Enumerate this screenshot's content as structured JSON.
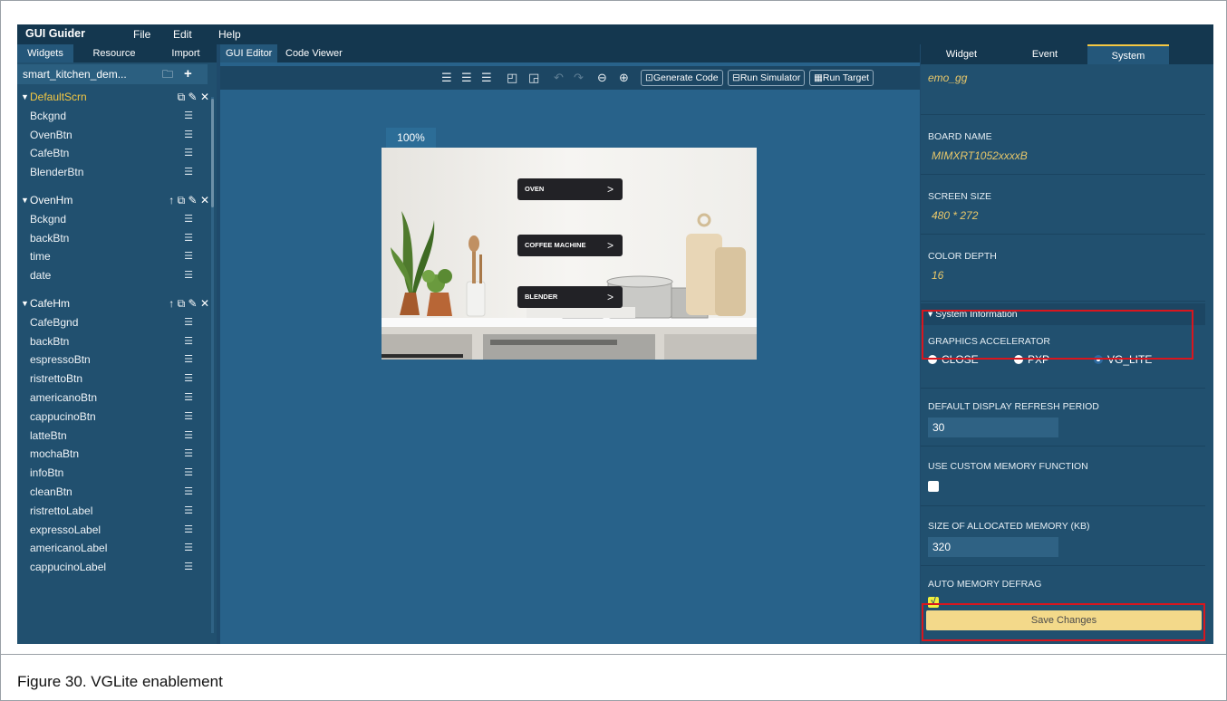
{
  "menubar": {
    "app_name": "GUI Guider",
    "items": [
      "File",
      "Edit",
      "Help"
    ]
  },
  "left": {
    "tabs": [
      "Widgets",
      "Resource",
      "Import"
    ],
    "project_name": "smart_kitchen_dem...",
    "screens": [
      {
        "name": "DefaultScrn",
        "children": [
          "Bckgnd",
          "OvenBtn",
          "CafeBtn",
          "BlenderBtn"
        ]
      },
      {
        "name": "OvenHm",
        "children": [
          "Bckgnd",
          "backBtn",
          "time",
          "date"
        ]
      },
      {
        "name": "CafeHm",
        "children": [
          "CafeBgnd",
          "backBtn",
          "espressoBtn",
          "ristrettoBtn",
          "americanoBtn",
          "cappucinoBtn",
          "latteBtn",
          "mochaBtn",
          "infoBtn",
          "cleanBtn",
          "ristrettoLabel",
          "expressoLabel",
          "americanoLabel",
          "cappucinoLabel"
        ]
      }
    ]
  },
  "center": {
    "tabs": [
      "GUI Editor",
      "Code Viewer"
    ],
    "toolbar": {
      "generate_code": "Generate Code",
      "run_simulator": "Run Simulator",
      "run_target": "Run Target"
    },
    "zoom": "100%",
    "preview": {
      "buttons": [
        "OVEN",
        "COFFEE MACHINE",
        "BLENDER"
      ]
    }
  },
  "right": {
    "tabs": [
      "Widget",
      "Event",
      "System"
    ],
    "top_value": "emo_gg",
    "board_name_label": "BOARD NAME",
    "board_name_value": "MIMXRT1052xxxxB",
    "screen_size_label": "SCREEN SIZE",
    "screen_size_value": "480 *  272",
    "color_depth_label": "COLOR DEPTH",
    "color_depth_value": "16",
    "system_info_label": "▾ System Information",
    "graphics_accel_label": "GRAPHICS ACCELERATOR",
    "graphics_options": [
      "CLOSE",
      "PXP",
      "VG_LITE"
    ],
    "graphics_selected": "VG_LITE",
    "refresh_label": "DEFAULT DISPLAY REFRESH PERIOD",
    "refresh_value": "30",
    "custom_mem_label": "USE CUSTOM MEMORY FUNCTION",
    "custom_mem_checked": false,
    "alloc_mem_label": "SIZE OF ALLOCATED MEMORY (KB)",
    "alloc_mem_value": "320",
    "defrag_label": "AUTO MEMORY DEFRAG",
    "defrag_checked": true,
    "save_label": "Save Changes"
  },
  "caption": "Figure 30. VGLite enablement",
  "colors": {
    "accent": "#f5c842",
    "highlight": "#d9161e",
    "panel": "#21506f",
    "canvas_bg": "#28628a"
  }
}
